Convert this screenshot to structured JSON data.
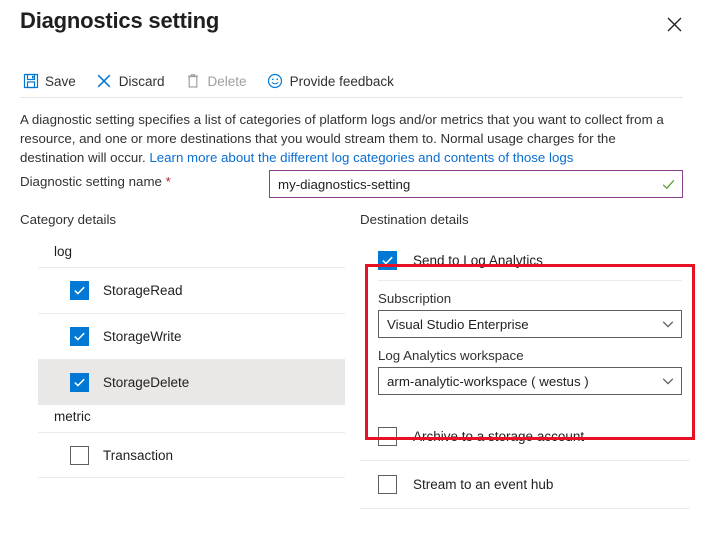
{
  "header": {
    "title": "Diagnostics setting",
    "close_icon": "close-icon"
  },
  "toolbar": {
    "items": [
      {
        "label": "Save",
        "icon": "save-floppy-icon",
        "disabled": false
      },
      {
        "label": "Discard",
        "icon": "discard-x-icon",
        "disabled": false
      },
      {
        "label": "Delete",
        "icon": "delete-trash-icon",
        "disabled": true
      },
      {
        "label": "Provide feedback",
        "icon": "smiley-feedback-icon",
        "disabled": false
      }
    ]
  },
  "description": {
    "text": "A diagnostic setting specifies a list of categories of platform logs and/or metrics that you want to collect from a resource, and one or more destinations that you would stream them to. Normal usage charges for the destination will occur. ",
    "link_text": "Learn more about the different log categories and contents of those logs",
    "link_color": "#0a6ed1"
  },
  "name_field": {
    "label": "Diagnostic setting name",
    "required_marker": "*",
    "value": "my-diagnostics-setting",
    "placeholder": "Enter setting name",
    "border_color": "#8a3f8a",
    "valid_icon": "green-check-icon",
    "valid_color": "#5a9e2f"
  },
  "category_details": {
    "heading": "Category details",
    "groups": [
      {
        "name": "log",
        "rows": [
          {
            "label": "StorageRead",
            "checked": true,
            "selected": false
          },
          {
            "label": "StorageWrite",
            "checked": true,
            "selected": false
          },
          {
            "label": "StorageDelete",
            "checked": true,
            "selected": true
          }
        ]
      },
      {
        "name": "metric",
        "rows": [
          {
            "label": "Transaction",
            "checked": false,
            "selected": false
          }
        ]
      }
    ]
  },
  "destination_details": {
    "heading": "Destination details",
    "highlight_color": "#e81123",
    "log_analytics": {
      "label": "Send to Log Analytics",
      "checked": true,
      "subscription": {
        "label": "Subscription",
        "value": "Visual Studio Enterprise"
      },
      "workspace": {
        "label": "Log Analytics workspace",
        "value": "arm-analytic-workspace ( westus )"
      }
    },
    "other_options": [
      {
        "label": "Archive to a storage account",
        "checked": false
      },
      {
        "label": "Stream to an event hub",
        "checked": false
      }
    ]
  },
  "colors": {
    "accent": "#0078d4",
    "highlight": "#e81123",
    "link": "#0a6ed1",
    "required": "#a4262c",
    "input_border": "#8a3f8a"
  }
}
